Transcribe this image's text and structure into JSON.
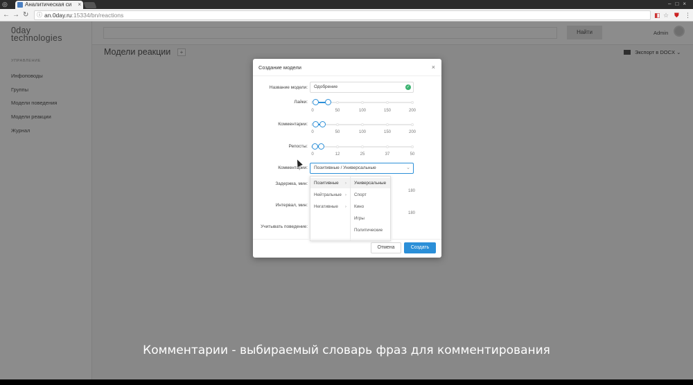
{
  "browser": {
    "tab_title": "Аналитическая си",
    "url_host": "an.0day.ru",
    "url_rest": ":15334/bn/reactions"
  },
  "app": {
    "logo_line1": "0day",
    "logo_line2": "technologies",
    "nav_header": "УПРАВЛЕНИЕ",
    "nav_items": [
      "Инфоповоды",
      "Группы",
      "Модели поведения",
      "Модели реакции",
      "Журнал"
    ],
    "search_button": "Найти",
    "user": "Admin",
    "page_title": "Модели реакции",
    "add_button": "+",
    "export_label": "Экспорт в DOCX"
  },
  "modal": {
    "title": "Создание модели",
    "close": "×",
    "name_label": "Название модели:",
    "name_value": "Одобрение",
    "likes_label": "Лайки:",
    "likes_ticks": [
      "0",
      "50",
      "100",
      "150",
      "200"
    ],
    "likes_range": [
      5,
      30
    ],
    "comments_label": "Комментарии:",
    "comments_ticks": [
      "0",
      "50",
      "100",
      "150",
      "200"
    ],
    "comments_range": [
      5,
      20
    ],
    "reposts_label": "Репосты:",
    "reposts_ticks": [
      "0",
      "12",
      "25",
      "37",
      "50"
    ],
    "reposts_range": [
      1,
      4
    ],
    "comments_select_label": "Комментарии:",
    "comments_select_value": "Позитивные / Универсальные",
    "delay_label": "Задержка, мин:",
    "delay_tick": "180",
    "interval_label": "Интервал, мин:",
    "interval_tick": "180",
    "behavior_label": "Учитывать поведение:",
    "cascade_level1": [
      "Позитивные",
      "Нейтральные",
      "Негативные"
    ],
    "cascade_level2": [
      "Универсальные",
      "Спорт",
      "Кино",
      "Игры",
      "Политические"
    ],
    "cancel_button": "Отмена",
    "create_button": "Создать"
  },
  "subtitle": "Комментарии - выбираемый словарь фраз для комментирования",
  "colors": {
    "accent": "#2b8fd8",
    "success": "#3cb371"
  }
}
